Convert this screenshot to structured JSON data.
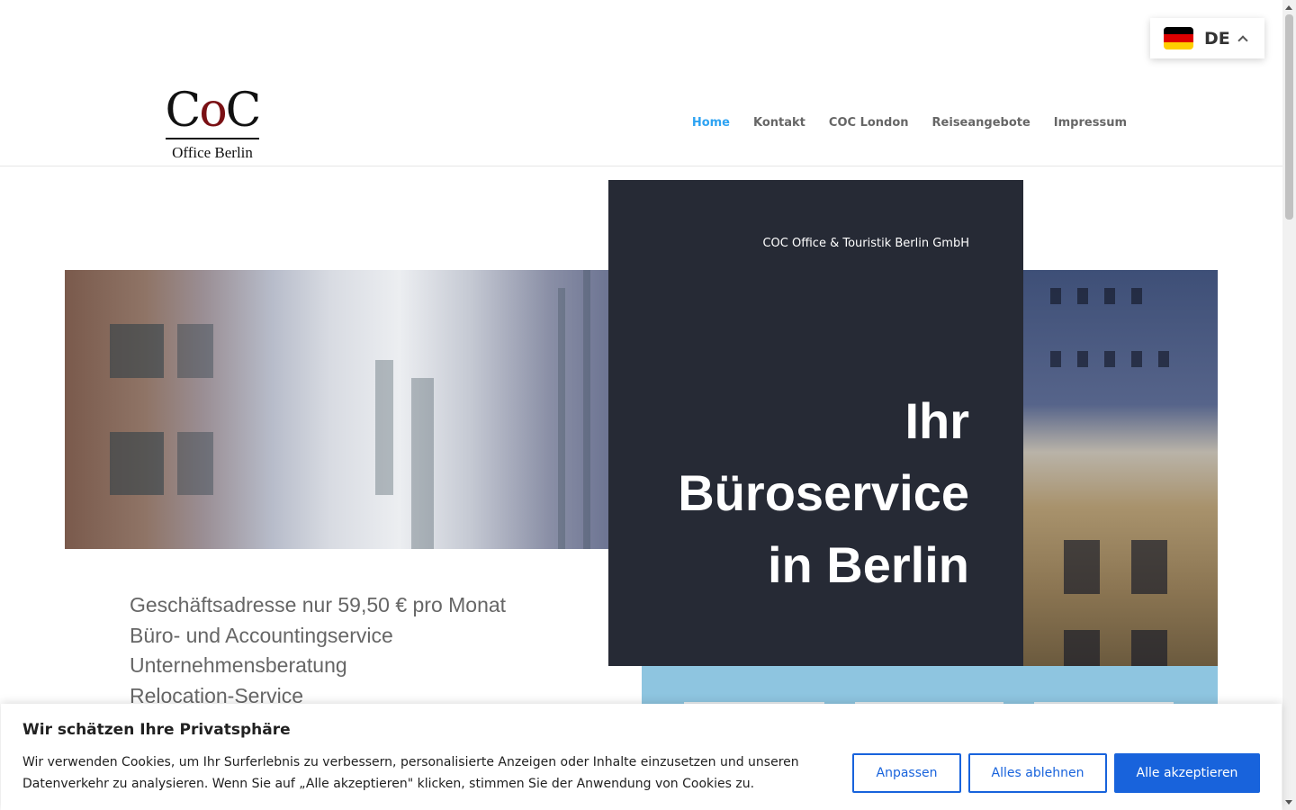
{
  "header": {
    "logo": {
      "mark_left": "C",
      "mark_mid": "o",
      "mark_right": "C",
      "subtitle": "Office Berlin"
    },
    "nav": [
      {
        "label": "Home",
        "active": true
      },
      {
        "label": "Kontakt",
        "active": false
      },
      {
        "label": "COC London",
        "active": false
      },
      {
        "label": "Reiseangebote",
        "active": false
      },
      {
        "label": "Impressum",
        "active": false
      }
    ],
    "language": {
      "code": "DE",
      "flag_icon": "german-flag-icon",
      "caret_icon": "chevron-up-icon",
      "flag_colors": [
        "#000000",
        "#dd0000",
        "#ffce00"
      ]
    }
  },
  "hero": {
    "company": "COC Office & Touristik Berlin GmbH",
    "title_lines": [
      "Ihr",
      "Büroservice",
      "in Berlin"
    ]
  },
  "services": [
    "Geschäftsadresse nur 59,50 € pro Monat",
    "Büro- und Accountingservice",
    "Unternehmensberatung",
    "Relocation-Service"
  ],
  "cookie_banner": {
    "title": "Wir schätzen Ihre Privatsphäre",
    "text": "Wir verwenden Cookies, um Ihr Surferlebnis zu verbessern, personalisierte Anzeigen oder Inhalte einzusetzen und unseren Datenverkehr zu analysieren. Wenn Sie auf „Alle akzeptieren\" klicken, stimmen Sie der Anwendung von Cookies zu.",
    "buttons": {
      "customize": "Anpassen",
      "reject": "Alles ablehnen",
      "accept": "Alle akzeptieren"
    }
  },
  "colors": {
    "accent": "#2ea3f2",
    "panel": "#262a35",
    "button_blue": "#1863dc",
    "band": "#8ec5e0"
  }
}
